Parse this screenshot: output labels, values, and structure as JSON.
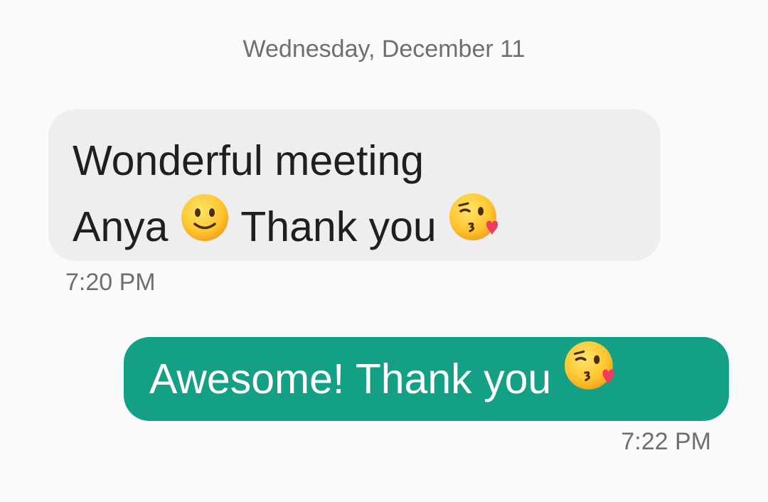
{
  "conversation": {
    "date_header": "Wednesday, December 11",
    "messages": [
      {
        "direction": "incoming",
        "line1": "Wonderful meeting",
        "line2_a": "Anya",
        "line2_b": "Thank you",
        "emojis": [
          "slightly-smiling-face",
          "face-blowing-a-kiss"
        ],
        "time": "7:20 PM"
      },
      {
        "direction": "outgoing",
        "text": "Awesome! Thank you",
        "emojis": [
          "face-blowing-a-kiss"
        ],
        "time": "7:22 PM"
      }
    ]
  },
  "colors": {
    "background": "#fafafc",
    "incoming_bubble": "#eeeeee",
    "outgoing_bubble": "#14a085",
    "timestamp_text": "#6f6f6f"
  }
}
